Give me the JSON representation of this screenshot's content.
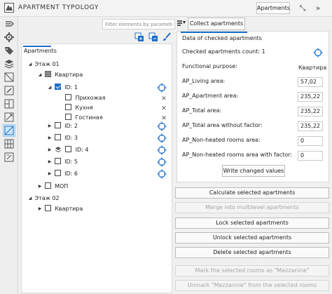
{
  "window": {
    "title": "APARTMENT TYPOLOGY",
    "tab_label": "Apartments"
  },
  "toolbar": {
    "filter_placeholder": "Filter elements by parameters",
    "collect_label": "Collect apartments"
  },
  "tree": {
    "tab_label": "Apartments",
    "rows": [
      {
        "text": "Этаж 01"
      },
      {
        "text": "Квартира"
      },
      {
        "text": "ID: 1"
      },
      {
        "text": "Прихожая"
      },
      {
        "text": "Кухня"
      },
      {
        "text": "Гостиная"
      },
      {
        "text": "ID: 2"
      },
      {
        "text": "ID: 3"
      },
      {
        "text": "ID: 4"
      },
      {
        "text": "ID: 5"
      },
      {
        "text": "ID: 6"
      },
      {
        "text": "МОП"
      },
      {
        "text": "Этаж 02"
      },
      {
        "text": "Квартира"
      }
    ]
  },
  "details": {
    "title": "Data of checked apartments",
    "count_label": "Checked apartments count: 1",
    "functional_purpose_label": "Functional purpose:",
    "functional_purpose_value": "Квартира",
    "fields": [
      {
        "label": "AP_Living area:",
        "value": "57,02"
      },
      {
        "label": "AP_Apartment area:",
        "value": "235,22"
      },
      {
        "label": "AP_Total area:",
        "value": "235,22"
      },
      {
        "label": "AP_Total area without factor:",
        "value": "235,22"
      },
      {
        "label": "AP_Non-heated rooms area:",
        "value": "0"
      },
      {
        "label": "AP_Non-heated rooms area with factor:",
        "value": "0"
      }
    ],
    "write_label": "Write changed values"
  },
  "actions": [
    {
      "label": "Calculate selected apartments",
      "enabled": true
    },
    {
      "label": "Merge into multilevel apartments",
      "enabled": false
    },
    {
      "label": "Lock selected apartments",
      "enabled": true
    },
    {
      "label": "Unlock selected apartments",
      "enabled": true
    },
    {
      "label": "Delete selected apartments",
      "enabled": true
    },
    {
      "label": "Mark the selected rooms as \"Mezzanine\"",
      "enabled": false
    },
    {
      "label": "Unmark \"Mezzanine\" from the selected rooms",
      "enabled": false
    }
  ],
  "colors": {
    "accent": "#1e6fc8"
  },
  "icons": {
    "logo": "logo-icon",
    "filter": "filter-list-icon",
    "pin": "pin-icon",
    "collapse": "collapse-icon",
    "target": "target-crosshair-icon",
    "remove": "close-icon"
  }
}
